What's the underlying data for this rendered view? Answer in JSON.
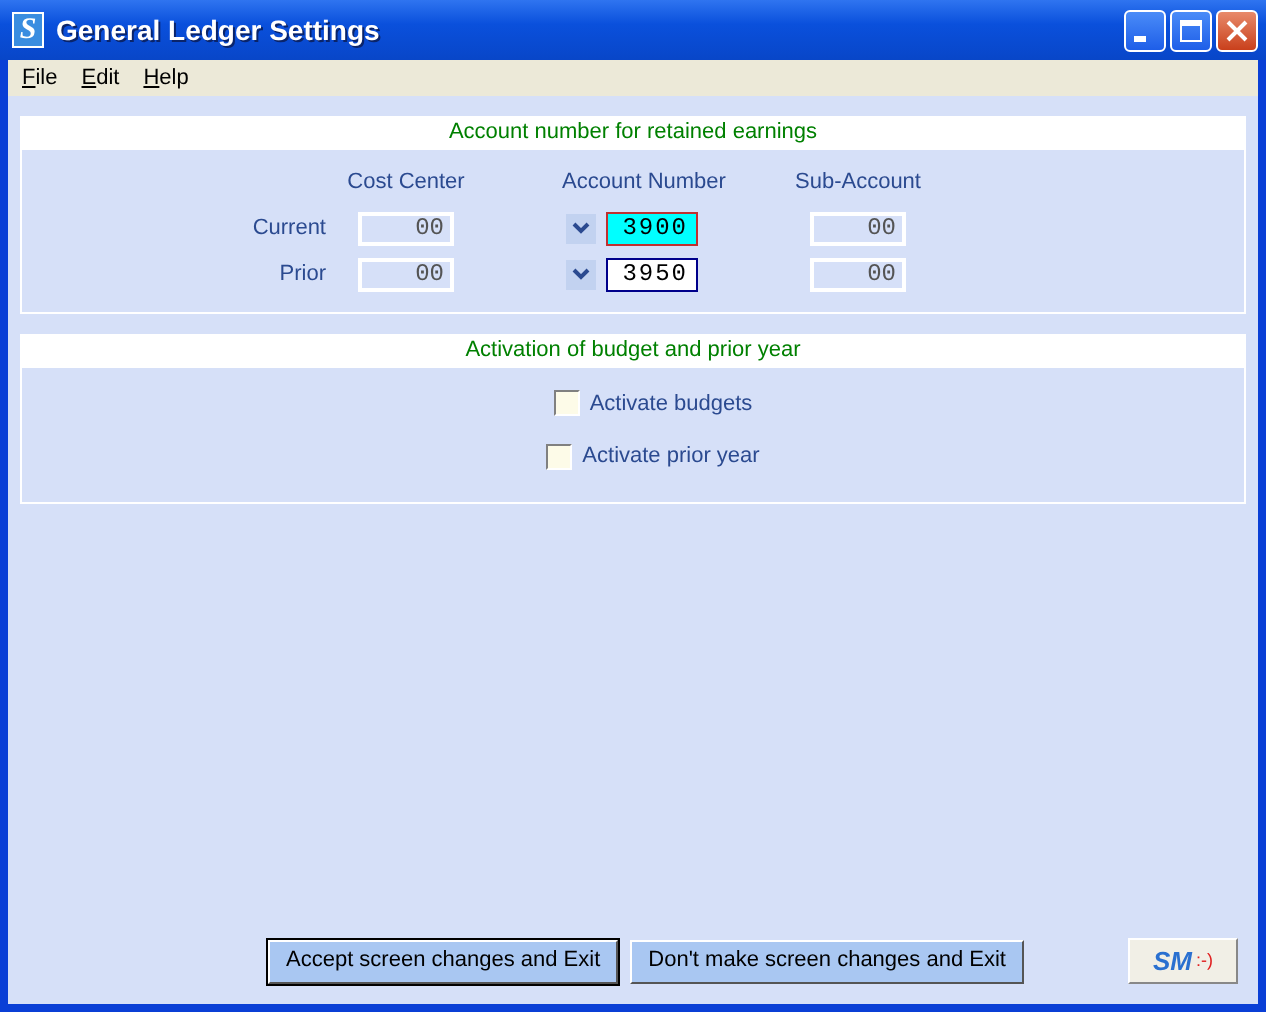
{
  "window": {
    "title": "General Ledger Settings",
    "icon_letter": "S"
  },
  "menu": [
    {
      "label": "File"
    },
    {
      "label": "Edit"
    },
    {
      "label": "Help"
    }
  ],
  "retained_earnings": {
    "heading": "Account number for retained earnings",
    "columns": [
      "Cost Center",
      "Account Number",
      "Sub-Account"
    ],
    "rows": [
      {
        "label": "Current",
        "cost_center": {
          "value": "00",
          "disabled": true
        },
        "account_number": {
          "value": "3900",
          "selected": true
        },
        "sub_account": {
          "value": "00",
          "disabled": true
        }
      },
      {
        "label": "Prior",
        "cost_center": {
          "value": "00",
          "disabled": true
        },
        "account_number": {
          "value": "3950",
          "selected": false
        },
        "sub_account": {
          "value": "00",
          "disabled": true
        }
      }
    ]
  },
  "activation": {
    "heading": "Activation of budget and prior year",
    "options": [
      {
        "label": "Activate budgets",
        "checked": false
      },
      {
        "label": "Activate prior year",
        "checked": false
      }
    ]
  },
  "buttons": [
    {
      "label": "Accept screen changes and Exit",
      "default": true
    },
    {
      "label": "Don't make screen changes and Exit",
      "default": false
    }
  ],
  "logo": {
    "letters": "SM",
    "smiley": ":-)"
  }
}
